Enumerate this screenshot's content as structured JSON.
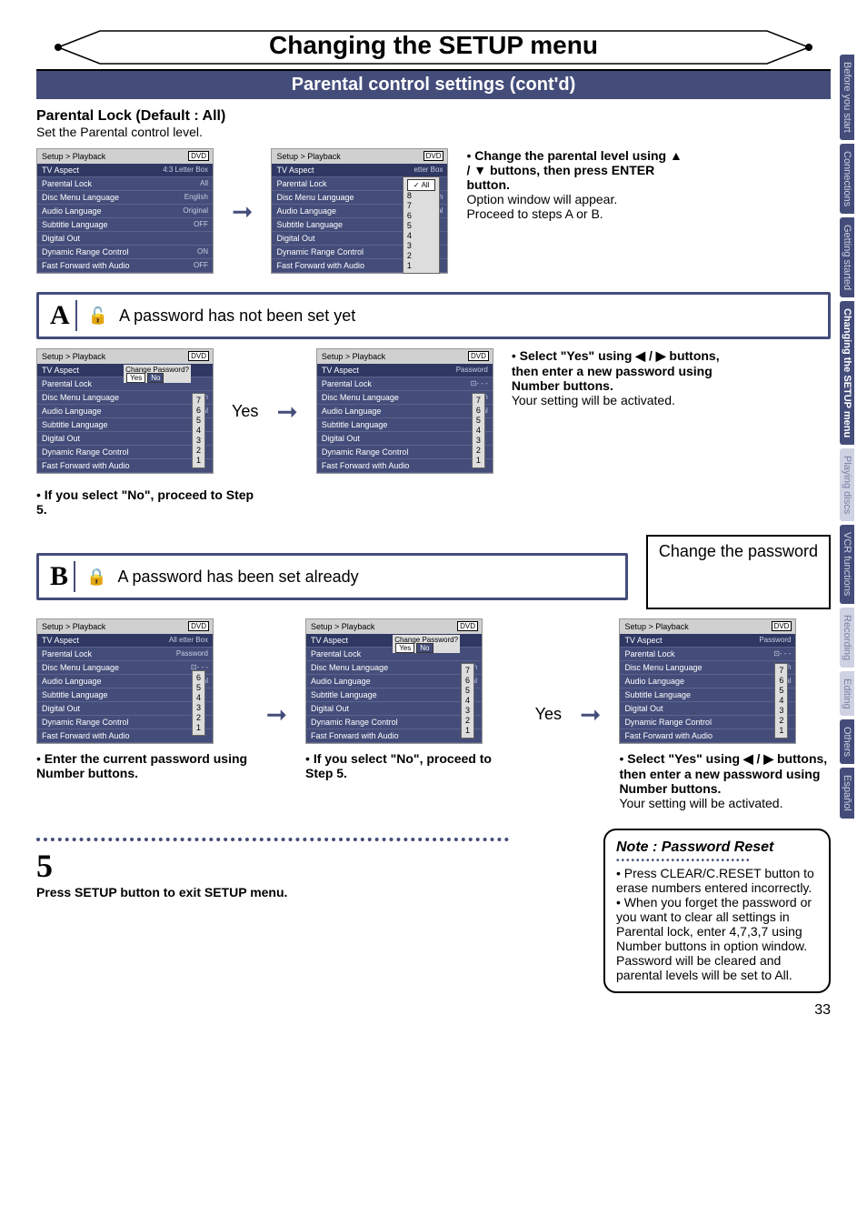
{
  "header": {
    "title": "Changing the SETUP menu",
    "subtitle": "Parental control settings (cont'd)"
  },
  "parental_lock": {
    "heading": "Parental Lock (Default : All)",
    "sub": "Set the Parental control level."
  },
  "side_tabs": [
    "Before you start",
    "Connections",
    "Getting started",
    "Changing the SETUP menu",
    "Playing discs",
    "VCR functions",
    "Recording",
    "Editing",
    "Others",
    "Español"
  ],
  "osd_common": {
    "crumb": "Setup > Playback",
    "dvd": "DVD",
    "rows": [
      "TV Aspect",
      "Parental Lock",
      "Disc Menu Language",
      "Audio Language",
      "Subtitle Language",
      "Digital Out",
      "Dynamic Range Control",
      "Fast Forward with Audio"
    ]
  },
  "osd1_vals": [
    "4:3 Letter Box",
    "All",
    "English",
    "Original",
    "OFF",
    "",
    "ON",
    "OFF"
  ],
  "osd_level_overlay": {
    "top": "✓ All",
    "levels": [
      "8",
      "7",
      "6",
      "5",
      "4",
      "3",
      "2",
      "1"
    ],
    "side": [
      "etter Box",
      "",
      "ish",
      "",
      "nal"
    ]
  },
  "osd_levels_only": [
    "7",
    "6",
    "5",
    "4",
    "3",
    "2",
    "1"
  ],
  "change_prompt": {
    "label": "Change Password?",
    "yes": "Yes",
    "no": "No"
  },
  "password_label": "Password",
  "instr_top": {
    "l1": "Change the parental level using ▲ / ▼ buttons, then press ENTER button.",
    "l2": "Option window will appear.",
    "l3": "Proceed to steps A or B."
  },
  "A": {
    "letter": "A",
    "text": "A password has not been set yet"
  },
  "A_yes": "Yes",
  "A_right": {
    "l1": "Select \"Yes\" using ◀ / ▶ buttons, then enter a new password using Number buttons.",
    "l2": "Your setting will be activated."
  },
  "A_no": "If you select \"No\", proceed to Step 5.",
  "B": {
    "letter": "B",
    "text": "A password has been set already",
    "change": "Change the password"
  },
  "B_cap1": "Enter the current password using Number buttons.",
  "B_cap2": "If you select \"No\", proceed to Step 5.",
  "B_yes": "Yes",
  "B_right": {
    "l1": "Select \"Yes\" using ◀ / ▶ buttons, then enter a new password using Number buttons.",
    "l2": "Your setting will be activated."
  },
  "note": {
    "title": "Note : Password Reset",
    "b1": "Press CLEAR/C.RESET button to erase numbers entered incorrectly.",
    "b2": "When you forget the password or you want to clear all settings in Parental lock, enter 4,7,3,7 using Number buttons in option window. Password will be cleared and parental levels will be set to All."
  },
  "step5": {
    "num": "5",
    "text": "Press SETUP button to exit SETUP menu."
  },
  "page_number": "33"
}
